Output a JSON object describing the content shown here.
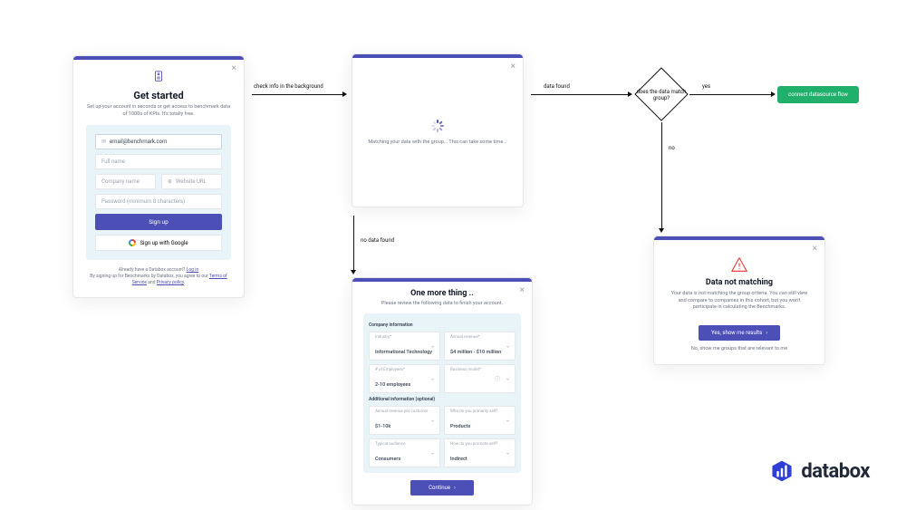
{
  "signup": {
    "title": "Get started",
    "subtitle": "Set up your account in seconds or get access to benchmark data of 1000s of KPIs. It's totally free.",
    "email": "email@benchmark.com",
    "fullname_placeholder": "Full name",
    "company_placeholder": "Company name",
    "website_placeholder": "Website URL",
    "password_placeholder": "Password (minimum 8 characters)",
    "signup_btn": "Sign up",
    "google_btn": "Sign up with Google",
    "already_text": "Already have a Databox account?",
    "login_link": "Log in",
    "terms_text": "By signing up for Benchmarks by Databox, you agree to our",
    "terms_link": "Terms of Service",
    "and_text": "and",
    "privacy_link": "Privacy policy"
  },
  "loading": {
    "text": "Matching your data with the group... This can take some time..."
  },
  "flow": {
    "check_bg": "check info in the background",
    "data_found": "data found",
    "no_data": "no data found",
    "decision": "does the data match group?",
    "yes": "yes",
    "no": "no",
    "endpoint": "connect datasource flow"
  },
  "onemore": {
    "title": "One more thing ..",
    "subtitle": "Please review the following data to finish your account.",
    "section_company": "Company information",
    "section_additional": "Additional information (optional)",
    "fields": {
      "industry_label": "Industry*",
      "industry_value": "Informational Technology",
      "revenue_label": "Annual revenue*",
      "revenue_value": "$4 million - $10 million",
      "employees_label": "# of Employees*",
      "employees_value": "2-10 employees",
      "bizmodel_label": "Business model*",
      "bizmodel_value": "",
      "arpc_label": "Annual revenue per customer",
      "arpc_value": "$1-10k",
      "sell_label": "Who do you primarily sell?",
      "sell_value": "Products",
      "audience_label": "Typical audience",
      "audience_value": "Consumers",
      "promote_label": "How do you promote self?",
      "promote_value": "Indirect"
    },
    "continue": "Continue"
  },
  "notmatching": {
    "title": "Data not matching",
    "body": "Your data is not matching the group criteria. You can still view and compare to companies in this cohort, but you won't participate in calculating the Benchmarks.",
    "btn": "Yes, show me results",
    "link": "No, show me groups that are relevant to me"
  },
  "logo": {
    "text": "databox"
  }
}
